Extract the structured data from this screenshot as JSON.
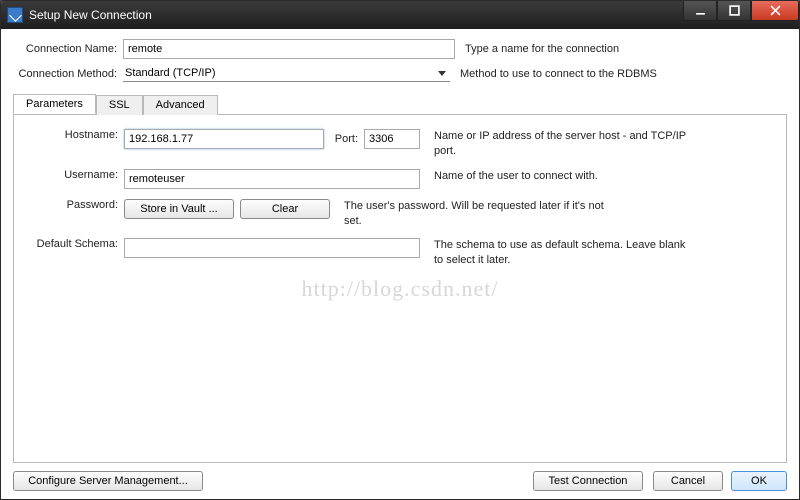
{
  "window": {
    "title": "Setup New Connection"
  },
  "form": {
    "connection_name_label": "Connection Name:",
    "connection_name_value": "remote",
    "connection_name_hint": "Type a name for the connection",
    "connection_method_label": "Connection Method:",
    "connection_method_value": "Standard (TCP/IP)",
    "connection_method_hint": "Method to use to connect to the RDBMS"
  },
  "tabs": {
    "parameters": "Parameters",
    "ssl": "SSL",
    "advanced": "Advanced"
  },
  "params": {
    "hostname_label": "Hostname:",
    "hostname_value": "192.168.1.77",
    "port_label": "Port:",
    "port_value": "3306",
    "hostname_desc": "Name or IP address of the server host - and TCP/IP port.",
    "username_label": "Username:",
    "username_value": "remoteuser",
    "username_desc": "Name of the user to connect with.",
    "password_label": "Password:",
    "store_vault_btn": "Store in Vault ...",
    "clear_btn": "Clear",
    "password_desc": "The user's password. Will be requested later if it's not set.",
    "schema_label": "Default Schema:",
    "schema_value": "",
    "schema_desc": "The schema to use as default schema. Leave blank to select it later."
  },
  "footer": {
    "configure_btn": "Configure Server Management...",
    "test_btn": "Test Connection",
    "cancel_btn": "Cancel",
    "ok_btn": "OK"
  },
  "watermark": "http://blog.csdn.net/"
}
